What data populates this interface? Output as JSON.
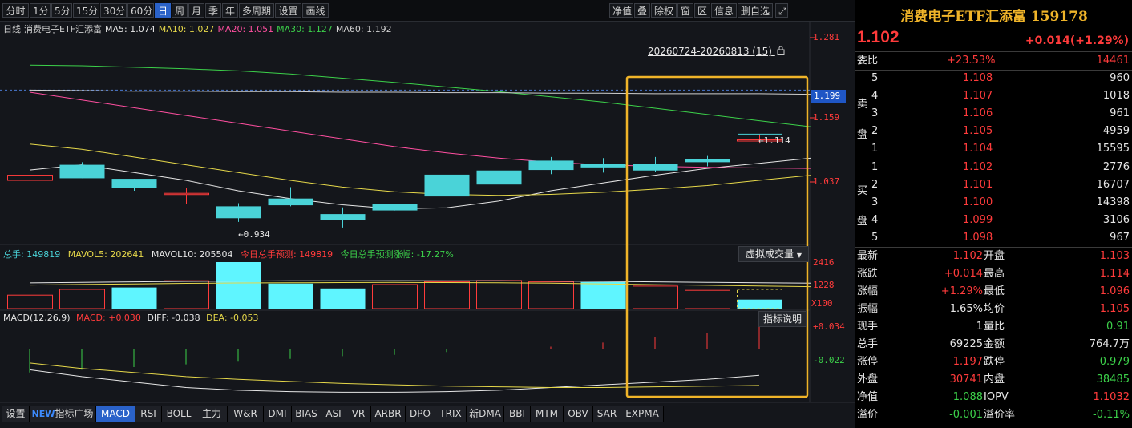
{
  "toolbar": {
    "left_buttons": [
      "分时",
      "1分",
      "5分",
      "15分",
      "30分",
      "60分",
      "日",
      "周",
      "月",
      "季",
      "年",
      "多周期",
      "设置",
      "画线"
    ],
    "active": "日",
    "right_buttons": [
      "净值",
      "叠",
      "除权",
      "窗",
      "区",
      "信息",
      "删自选"
    ]
  },
  "ma_legend": [
    {
      "text": "日线",
      "color": "#d0d0d0"
    },
    {
      "text": "消费电子ETF汇添富",
      "color": "#d0d0d0"
    },
    {
      "text": "MA5: 1.074",
      "color": "#e6e6e6"
    },
    {
      "text": "MA10: 1.027",
      "color": "#e6d84a"
    },
    {
      "text": "MA20: 1.051",
      "color": "#ff4fa0"
    },
    {
      "text": "MA30: 1.127",
      "color": "#3cd14a"
    },
    {
      "text": "MA60: 1.192",
      "color": "#d0d0d0"
    }
  ],
  "period_range": "20260724-20260813 (15)",
  "price_scale": {
    "labels": [
      "1.281",
      "1.159",
      "1.037"
    ],
    "current": "1.199",
    "high_marker": "1.114",
    "low_marker": "0.934"
  },
  "chart_data": {
    "type": "candlestick",
    "ohlc": [
      {
        "o": 1.025,
        "h": 1.045,
        "l": 1.025,
        "c": 1.035
      },
      {
        "o": 1.055,
        "h": 1.06,
        "l": 1.04,
        "c": 1.029
      },
      {
        "o": 1.028,
        "h": 1.026,
        "l": 1.005,
        "c": 1.01
      },
      {
        "o": 1.0,
        "h": 1.01,
        "l": 0.98,
        "c": 1.0
      },
      {
        "o": 0.975,
        "h": 0.981,
        "l": 0.945,
        "c": 0.952
      },
      {
        "o": 0.99,
        "h": 1.012,
        "l": 0.975,
        "c": 0.977
      },
      {
        "o": 0.96,
        "h": 0.973,
        "l": 0.934,
        "c": 0.949
      },
      {
        "o": 0.98,
        "h": 0.98,
        "l": 0.97,
        "c": 0.967
      },
      {
        "o": 1.036,
        "h": 1.04,
        "l": 0.99,
        "c": 0.994
      },
      {
        "o": 1.044,
        "h": 1.055,
        "l": 1.008,
        "c": 1.017
      },
      {
        "o": 1.063,
        "h": 1.07,
        "l": 1.037,
        "c": 1.045
      },
      {
        "o": 1.057,
        "h": 1.068,
        "l": 1.04,
        "c": 1.05
      },
      {
        "o": 1.056,
        "h": 1.07,
        "l": 1.042,
        "c": 1.044
      },
      {
        "o": 1.066,
        "h": 1.072,
        "l": 1.052,
        "c": 1.06
      },
      {
        "o": 1.102,
        "h": 1.114,
        "l": 1.096,
        "c": 1.103
      }
    ],
    "ylim": [
      0.92,
      1.3
    ],
    "ma": {
      "MA5": [
        1.045,
        1.055,
        1.04,
        1.025,
        1.005,
        0.99,
        0.978,
        0.97,
        0.972,
        0.985,
        1.005,
        1.02,
        1.035,
        1.048,
        1.058,
        1.068
      ],
      "MA10": [
        1.095,
        1.085,
        1.07,
        1.055,
        1.04,
        1.025,
        1.012,
        1.003,
        0.998,
        0.996,
        0.998,
        1.002,
        1.008,
        1.015,
        1.025,
        1.035
      ],
      "MA20": [
        1.195,
        1.18,
        1.165,
        1.15,
        1.135,
        1.12,
        1.105,
        1.09,
        1.078,
        1.068,
        1.06,
        1.055,
        1.052,
        1.05,
        1.049,
        1.048
      ],
      "MA30": [
        1.247,
        1.246,
        1.243,
        1.24,
        1.236,
        1.23,
        1.222,
        1.214,
        1.205,
        1.196,
        1.186,
        1.176,
        1.164,
        1.152,
        1.14,
        1.128
      ],
      "MA60": [
        1.199,
        1.198,
        1.197,
        1.197,
        1.196,
        1.196,
        1.195,
        1.195,
        1.194,
        1.194,
        1.193,
        1.193,
        1.192,
        1.192,
        1.192,
        1.191
      ]
    },
    "volume": [
      {
        "v": 700,
        "up": true
      },
      {
        "v": 1000,
        "up": true
      },
      {
        "v": 1100,
        "up": false
      },
      {
        "v": 1450,
        "up": true
      },
      {
        "v": 2416,
        "up": false
      },
      {
        "v": 1300,
        "up": false
      },
      {
        "v": 1050,
        "up": false
      },
      {
        "v": 1250,
        "up": true
      },
      {
        "v": 1400,
        "up": true
      },
      {
        "v": 1460,
        "up": true
      },
      {
        "v": 1390,
        "up": true
      },
      {
        "v": 1380,
        "up": false
      },
      {
        "v": 1170,
        "up": true
      },
      {
        "v": 950,
        "up": true
      },
      {
        "v": 470,
        "up": false
      }
    ],
    "volume_forecast": 1000,
    "macd": [
      -0.034,
      -0.03,
      -0.026,
      -0.022,
      -0.018,
      -0.014,
      -0.01,
      -0.008,
      -0.004,
      0.0,
      0.004,
      0.01,
      0.018,
      0.024,
      0.034
    ],
    "diff": [
      -0.03,
      -0.04,
      -0.048,
      -0.056,
      -0.06,
      -0.062,
      -0.063,
      -0.063,
      -0.062,
      -0.06,
      -0.056,
      -0.052,
      -0.048,
      -0.044,
      -0.038
    ],
    "dea": [
      -0.02,
      -0.028,
      -0.034,
      -0.04,
      -0.044,
      -0.047,
      -0.05,
      -0.052,
      -0.054,
      -0.055,
      -0.056,
      -0.056,
      -0.055,
      -0.054,
      -0.053
    ]
  },
  "volume_legend": {
    "total_hand": "总手: 149819",
    "mavol5": "MAVOL5: 202641",
    "mavol10": "MAVOL10: 205504",
    "forecast": "今日总手预测: 149819",
    "forecast_change": "今日总手预测涨幅: -17.27%"
  },
  "virtual_volume_button": "虚拟成交量",
  "volume_scale": {
    "top": "2416",
    "mid": "1228",
    "unit": "X100"
  },
  "macd_legend": {
    "params": "MACD(12,26,9)",
    "macd": "MACD: +0.030",
    "diff": "DIFF: -0.038",
    "dea": "DEA: -0.053"
  },
  "macd_help_button": "指标说明",
  "macd_scale": {
    "top": "+0.034",
    "mid": "-0.022"
  },
  "bottom_tabs": {
    "settings": "设置",
    "new_badge": "NEW",
    "plaza": "指标广场",
    "indicators": [
      "MACD",
      "RSI",
      "BOLL",
      "主力",
      "W&R",
      "DMI",
      "BIAS",
      "ASI",
      "VR",
      "ARBR",
      "DPO",
      "TRIX",
      "新DMA",
      "BBI",
      "MTM",
      "OBV",
      "SAR",
      "EXPMA"
    ],
    "active": "MACD"
  },
  "quote": {
    "title": "消费电子ETF汇添富 159178",
    "price": "1.102",
    "change": "+0.014(+1.29%)",
    "weibi_label": "委比",
    "weibi_pct": "+23.53%",
    "weibi_diff": "14461",
    "sell_label": [
      "卖",
      "盘"
    ],
    "buy_label": [
      "买",
      "盘"
    ],
    "sells": [
      {
        "level": "5",
        "price": "1.108",
        "vol": "960"
      },
      {
        "level": "4",
        "price": "1.107",
        "vol": "1018"
      },
      {
        "level": "3",
        "price": "1.106",
        "vol": "961"
      },
      {
        "level": "2",
        "price": "1.105",
        "vol": "4959"
      },
      {
        "level": "1",
        "price": "1.104",
        "vol": "15595"
      }
    ],
    "buys": [
      {
        "level": "1",
        "price": "1.102",
        "vol": "2776"
      },
      {
        "level": "2",
        "price": "1.101",
        "vol": "16707"
      },
      {
        "level": "3",
        "price": "1.100",
        "vol": "14398"
      },
      {
        "level": "4",
        "price": "1.099",
        "vol": "3106"
      },
      {
        "level": "5",
        "price": "1.098",
        "vol": "967"
      }
    ],
    "stats": [
      {
        "l1": "最新",
        "v1": "1.102",
        "c1": "red",
        "l2": "开盘",
        "v2": "1.103",
        "c2": "red"
      },
      {
        "l1": "涨跌",
        "v1": "+0.014",
        "c1": "red",
        "l2": "最高",
        "v2": "1.114",
        "c2": "red"
      },
      {
        "l1": "涨幅",
        "v1": "+1.29%",
        "c1": "red",
        "l2": "最低",
        "v2": "1.096",
        "c2": "red"
      },
      {
        "l1": "振幅",
        "v1": "1.65%",
        "c1": "white",
        "l2": "均价",
        "v2": "1.105",
        "c2": "red"
      },
      {
        "l1": "现手",
        "v1": "1",
        "c1": "white",
        "l2": "量比",
        "v2": "0.91",
        "c2": "green"
      },
      {
        "l1": "总手",
        "v1": "69225",
        "c1": "white",
        "l2": "金额",
        "v2": "764.7万",
        "c2": "white"
      },
      {
        "l1": "涨停",
        "v1": "1.197",
        "c1": "red",
        "l2": "跌停",
        "v2": "0.979",
        "c2": "green"
      },
      {
        "l1": "外盘",
        "v1": "30741",
        "c1": "red",
        "l2": "内盘",
        "v2": "38485",
        "c2": "green"
      },
      {
        "l1": "净值",
        "v1": "1.088",
        "c1": "green",
        "l2": "IOPV",
        "v2": "1.1032",
        "c2": "red"
      },
      {
        "l1": "溢价",
        "v1": "-0.001",
        "c1": "green",
        "l2": "溢价率",
        "v2": "-0.11%",
        "c2": "green"
      }
    ]
  },
  "colors": {
    "up": "#ff3b3b",
    "down": "#4ad3d8",
    "vol_down": "#5ff5ff",
    "ma5": "#e6e6e6",
    "ma10": "#e6d84a",
    "ma20": "#ff4fa0",
    "ma30": "#3cd14a",
    "ma60": "#d0d0d0",
    "highlight": "#f0b429",
    "title": "#f0b429",
    "current_price_bg": "#1f56c5"
  }
}
